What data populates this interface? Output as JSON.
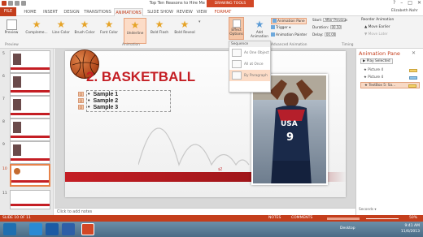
{
  "window": {
    "title": "Top Ten Reasons to Hire Me EAN - PowerPoint",
    "contextual_tab": "DRAWING TOOLS",
    "controls": [
      "?",
      "–",
      "□",
      "✕"
    ],
    "user": "Elizabeth Nohr"
  },
  "tabs": [
    "FILE",
    "HOME",
    "INSERT",
    "DESIGN",
    "TRANSITIONS",
    "ANIMATIONS",
    "SLIDE SHOW",
    "REVIEW",
    "VIEW",
    "FORMAT"
  ],
  "active_tab": "ANIMATIONS",
  "ribbon": {
    "preview": "Preview",
    "effects": [
      "Compleme...",
      "Line Color",
      "Brush Color",
      "Font Color",
      "Underline",
      "Bold Flash",
      "Bold Reveal"
    ],
    "group_preview": "Preview",
    "group_animation": "Animation",
    "effect_options": "Effect Options",
    "add_animation": "Add Animation",
    "animation_pane": "Animation Pane",
    "trigger": "Trigger",
    "animation_painter": "Animation Painter",
    "group_advanced": "Advanced Animation",
    "start_label": "Start:",
    "start_value": "After Previous",
    "duration_label": "Duration:",
    "duration_value": "00.50",
    "delay_label": "Delay:",
    "delay_value": "00.00",
    "reorder": "Reorder Animation",
    "move_earlier": "Move Earlier",
    "move_later": "Move Later",
    "group_timing": "Timing"
  },
  "dropdown": {
    "header": "Sequence",
    "items": [
      "As One Object",
      "All at Once",
      "By Paragraph"
    ],
    "selected": "By Paragraph"
  },
  "thumbnails": [
    "5",
    "6",
    "7",
    "8",
    "9",
    "10",
    "11"
  ],
  "selected_slide": "10",
  "slide": {
    "title": "2. BASKETBALL",
    "bullets": [
      "Sample 1",
      "Sample 2",
      "Sample 3"
    ],
    "anim_tags": [
      "0",
      "0",
      "0"
    ],
    "jersey": "USA 9"
  },
  "notes_placeholder": "Click to add notes",
  "animation_pane": {
    "title": "Animation Pane",
    "play": "Play Selected",
    "items": [
      "Picture 4",
      "Picture 4",
      "TextBox 5: Sa..."
    ],
    "footer": "Seconds ▾"
  },
  "status": {
    "slide": "SLIDE 10 OF 11",
    "notes": "NOTES",
    "comments": "COMMENTS",
    "zoom": "50%"
  },
  "taskbar": {
    "desktop": "Desktop",
    "time": "9:41 AM",
    "date": "11/6/2013"
  },
  "colors": {
    "accent": "#c43e1c",
    "slide_red": "#c41e24",
    "selection": "#f7d9c5"
  }
}
